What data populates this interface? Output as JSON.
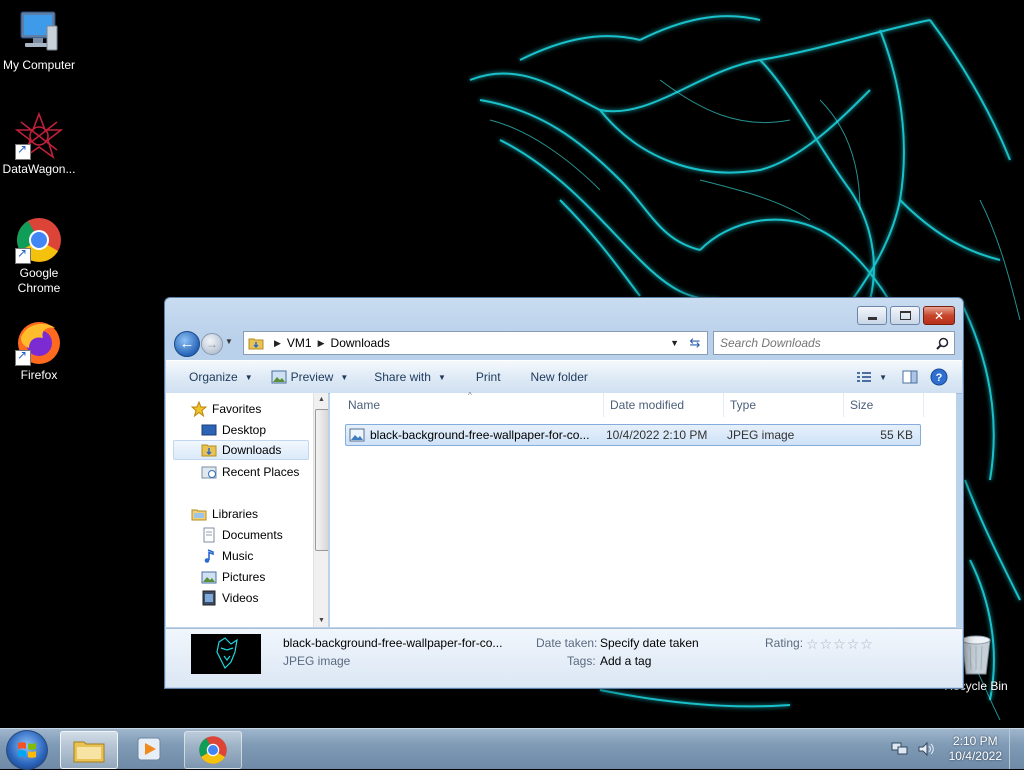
{
  "desktop": {
    "icons": [
      {
        "label": "My Computer"
      },
      {
        "label": "DataWagon..."
      },
      {
        "label": "Google Chrome"
      },
      {
        "label": "Firefox"
      }
    ],
    "recycle_bin": "Recycle Bin"
  },
  "explorer": {
    "breadcrumb": [
      "VM1",
      "Downloads"
    ],
    "search_placeholder": "Search Downloads",
    "toolbar": {
      "organize": "Organize",
      "preview": "Preview",
      "share_with": "Share with",
      "print": "Print",
      "new_folder": "New folder"
    },
    "nav": {
      "favorites": "Favorites",
      "desktop": "Desktop",
      "downloads": "Downloads",
      "recent_places": "Recent Places",
      "libraries": "Libraries",
      "documents": "Documents",
      "music": "Music",
      "pictures": "Pictures",
      "videos": "Videos"
    },
    "columns": [
      "Name",
      "Date modified",
      "Type",
      "Size"
    ],
    "files": [
      {
        "name": "black-background-free-wallpaper-for-co...",
        "date": "10/4/2022 2:10 PM",
        "type": "JPEG image",
        "size": "55 KB"
      }
    ],
    "details": {
      "name": "black-background-free-wallpaper-for-co...",
      "type": "JPEG image",
      "date_taken_label": "Date taken:",
      "date_taken_value": "Specify date taken",
      "tags_label": "Tags:",
      "tags_value": "Add a tag",
      "rating_label": "Rating:"
    }
  },
  "taskbar": {
    "time": "2:10 PM",
    "date": "10/4/2022"
  },
  "colors": {
    "accent": "#2765b8",
    "selection": "#cfe2f8",
    "wallpaper_glow": "#1fd6e0"
  }
}
